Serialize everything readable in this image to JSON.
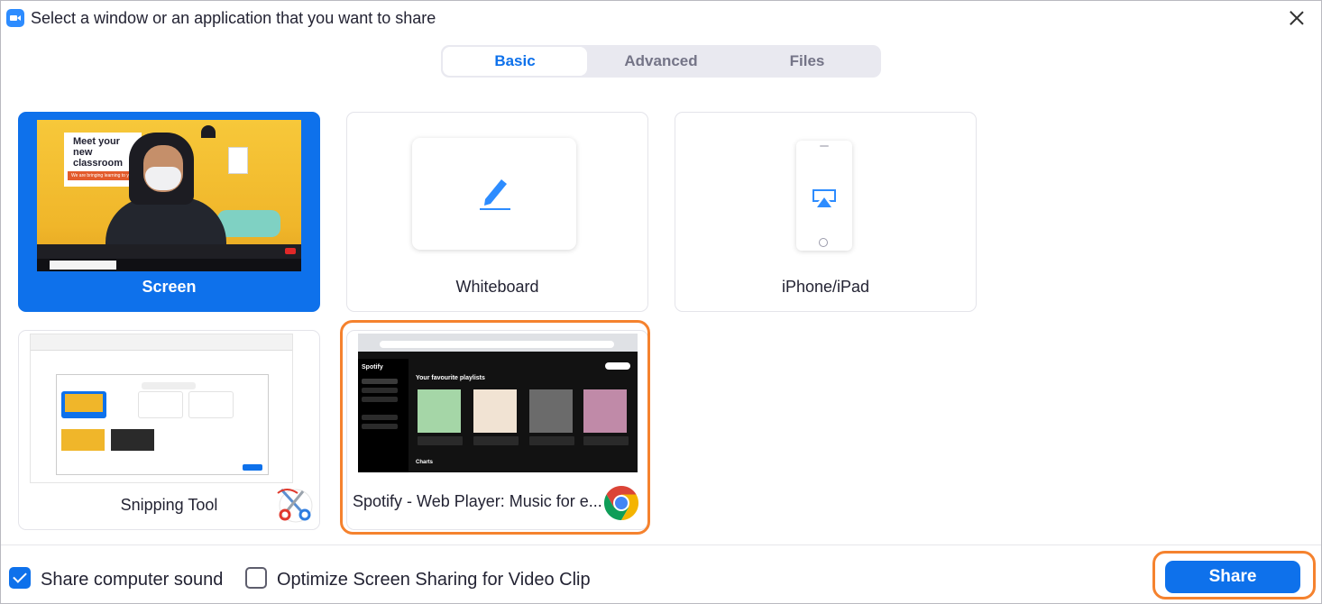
{
  "window": {
    "title": "Select a window or an application that you want to share"
  },
  "tabs": [
    {
      "label": "Basic",
      "active": true
    },
    {
      "label": "Advanced",
      "active": false
    },
    {
      "label": "Files",
      "active": false
    }
  ],
  "tiles": {
    "screen": {
      "label": "Screen",
      "selected": true,
      "thumb_text": "Meet your new classroom",
      "thumb_sub": "We are bringing learning to you."
    },
    "whiteboard": {
      "label": "Whiteboard"
    },
    "iphone": {
      "label": "iPhone/iPad"
    },
    "snipping": {
      "label": "Snipping Tool"
    },
    "spotify": {
      "label": "Spotify - Web Player: Music for e...",
      "thumb": {
        "logo": "Spotify",
        "heading": "Your favourite playlists",
        "section": "Charts"
      }
    }
  },
  "footer": {
    "share_sound_label": "Share computer sound",
    "share_sound_checked": true,
    "optimize_label": "Optimize Screen Sharing for Video Clip",
    "optimize_checked": false,
    "share_button": "Share"
  },
  "colors": {
    "accent": "#0e71eb",
    "highlight": "#f5822e"
  }
}
